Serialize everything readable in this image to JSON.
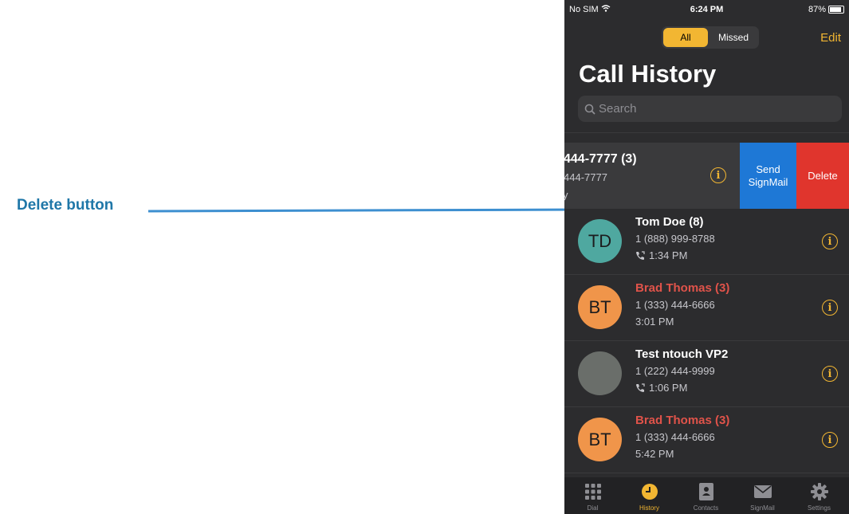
{
  "annotation": {
    "label": "Delete button"
  },
  "status_bar": {
    "carrier": "No SIM",
    "time": "6:24 PM",
    "battery": "87%"
  },
  "segmented": {
    "all": "All",
    "missed": "Missed",
    "selected": "All"
  },
  "edit_label": "Edit",
  "title": "Call History",
  "search": {
    "placeholder": "Search"
  },
  "swiped_row": {
    "name": "444-7777 (3)",
    "number": "444-7777",
    "sub": "y"
  },
  "actions": {
    "send": "Send SignMail",
    "delete": "Delete"
  },
  "calls": [
    {
      "initials": "TD",
      "name": "Tom Doe (8)",
      "number": "1 (888) 999-8788",
      "time": "1:34 PM",
      "missed": false,
      "outgoing": true,
      "avatar_color": "#4fa8a0"
    },
    {
      "initials": "BT",
      "name": "Brad Thomas (3)",
      "number": "1 (333) 444-6666",
      "time": "3:01 PM",
      "missed": true,
      "outgoing": false,
      "avatar_color": "#f0954a"
    },
    {
      "initials": "",
      "name": "Test ntouch VP2",
      "number": "1 (222) 444-9999",
      "time": "1:06 PM",
      "missed": false,
      "outgoing": true,
      "avatar_color": "#6a6e6a"
    },
    {
      "initials": "BT",
      "name": "Brad Thomas (3)",
      "number": "1 (333) 444-6666",
      "time": "5:42 PM",
      "missed": true,
      "outgoing": false,
      "avatar_color": "#f0954a"
    }
  ],
  "tabs": [
    {
      "label": "Dial",
      "icon": "keypad-icon",
      "active": false
    },
    {
      "label": "History",
      "icon": "clock-icon",
      "active": true
    },
    {
      "label": "Contacts",
      "icon": "contacts-icon",
      "active": false
    },
    {
      "label": "SignMail",
      "icon": "envelope-icon",
      "active": false
    },
    {
      "label": "Settings",
      "icon": "gear-icon",
      "active": false
    }
  ],
  "colors": {
    "accent": "#f2b632",
    "delete": "#e0352d",
    "send": "#1e78d6",
    "annotation": "#1f77a8",
    "missed": "#e0534a"
  }
}
